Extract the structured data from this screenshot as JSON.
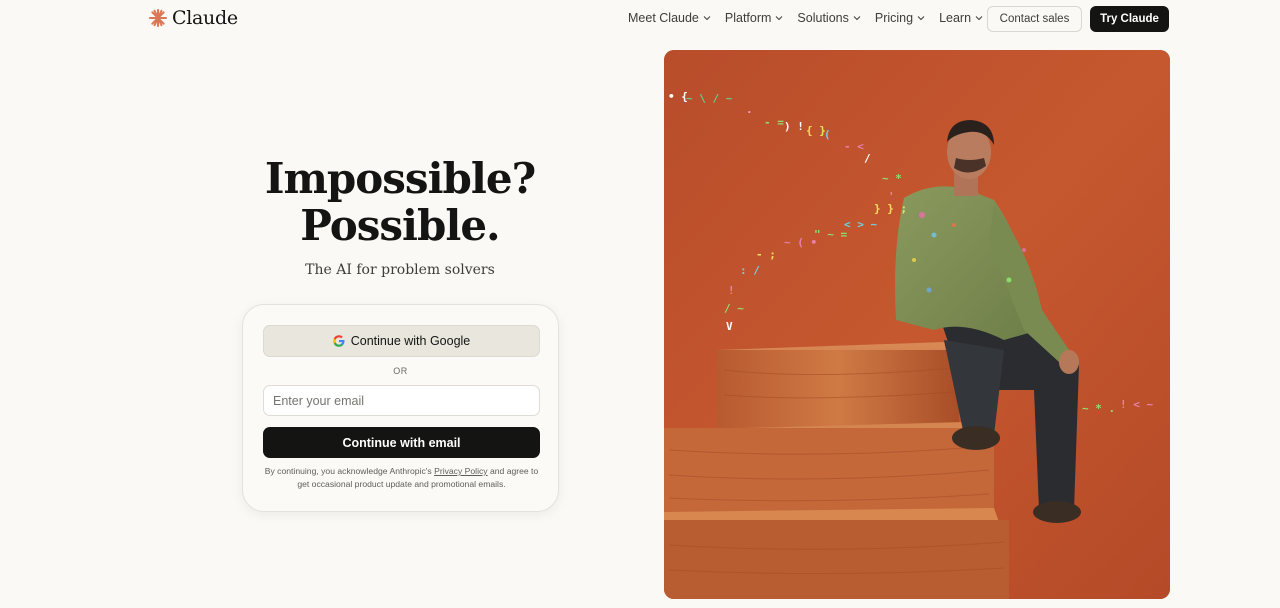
{
  "header": {
    "logo_text": "Claude",
    "nav": [
      {
        "label": "Meet Claude"
      },
      {
        "label": "Platform"
      },
      {
        "label": "Solutions"
      },
      {
        "label": "Pricing"
      },
      {
        "label": "Learn"
      }
    ],
    "contact_label": "Contact sales",
    "try_label": "Try Claude"
  },
  "hero": {
    "title_line1": "Impossible?",
    "title_line2": "Possible.",
    "subtitle": "The AI for problem solvers"
  },
  "signup": {
    "google_label": "Continue with Google",
    "or_label": "OR",
    "email_placeholder": "Enter your email",
    "email_button": "Continue with email",
    "legal_prefix": "By continuing, you acknowledge Anthropic's",
    "legal_link": "Privacy Policy",
    "legal_suffix": "and agree to get occasional product update and promotional emails."
  },
  "colors": {
    "background": "#faf9f5",
    "accent": "#d97757",
    "primary_button": "#141413",
    "image_bg": "#c2542e"
  }
}
